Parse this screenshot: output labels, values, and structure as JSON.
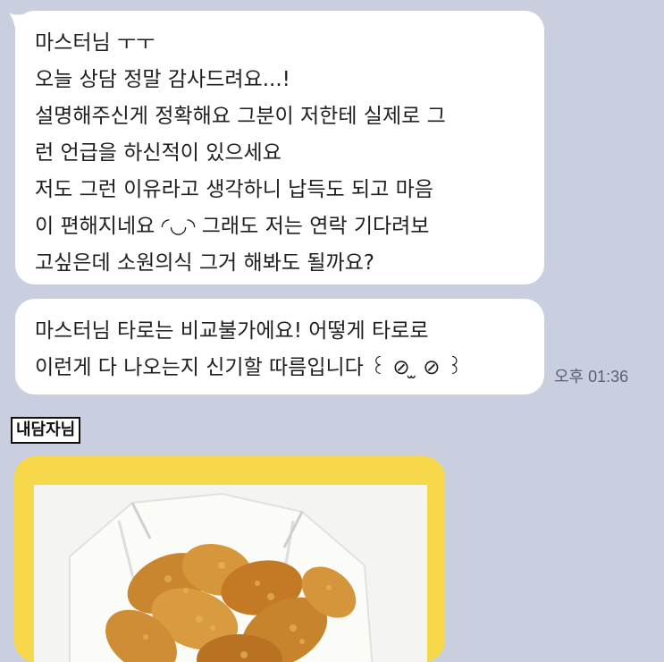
{
  "messages": {
    "first": {
      "lines": [
        "마스터님 ㅜㅜ",
        "오늘 상담 정말 감사드려요...!",
        "설명해주신게 정확해요 그분이 저한테 실제로 그",
        "런 언급을 하신적이 있으세요",
        "저도 그런 이유라고 생각하니 납득도 되고 마음",
        "이 편해지네요 ◜◡◝ 그래도 저는 연락 기다려보",
        "고싶은데 소원의식 그거 해봐도 될까요?"
      ]
    },
    "second": {
      "lines": [
        "마스터님 타로는 비교불가에요! 어떻게 타로로",
        "이런게 다 나오는지 신기할 따름입니다 ꒰ ⊘ ̫ ⊘ ꒱"
      ]
    },
    "timestamp": "오후 01:36"
  },
  "sender": {
    "name": "내담자님"
  },
  "image_card": {
    "subject": "fried-chicken-photo",
    "frame_color": "#f7d84a"
  },
  "colors": {
    "background": "#c9cfdf",
    "bubble": "#ffffff"
  }
}
